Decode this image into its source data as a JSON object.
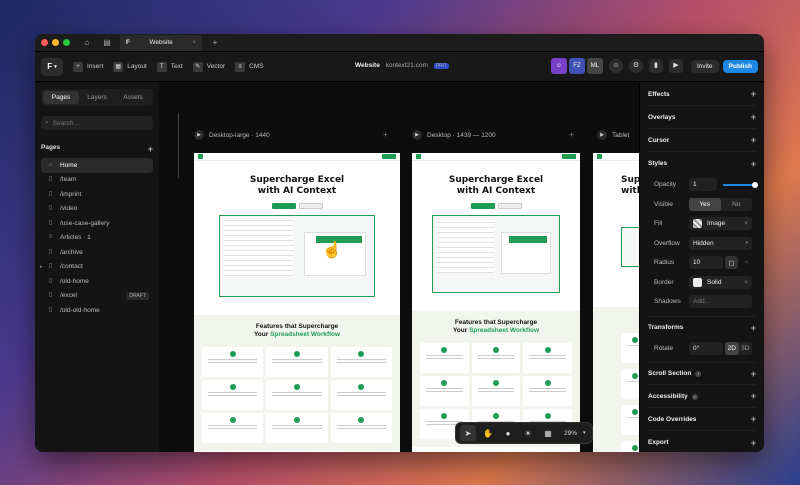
{
  "window": {
    "tab_title": "Website",
    "new_tab": "+",
    "close_tab": "×"
  },
  "toolbar": {
    "logo": "F",
    "tools": [
      {
        "icon": "plus-icon",
        "glyph": "+",
        "label": "Insert"
      },
      {
        "icon": "layout-icon",
        "glyph": "▦",
        "label": "Layout"
      },
      {
        "icon": "text-icon",
        "glyph": "T",
        "label": "Text"
      },
      {
        "icon": "vector-icon",
        "glyph": "✎",
        "label": "Vector"
      },
      {
        "icon": "cms-icon",
        "glyph": "≡",
        "label": "CMS"
      }
    ],
    "project_title": "Website",
    "domain": "kontext21.com",
    "plan_badge": "PRO",
    "avatar_1": "FZ",
    "avatar_2": "ML",
    "invite_label": "Invite",
    "publish_label": "Publish"
  },
  "left_panel": {
    "tabs": [
      "Pages",
      "Layers",
      "Assets"
    ],
    "active_tab": "Pages",
    "search_placeholder": "Search...",
    "pages_heading": "Pages",
    "pages": [
      {
        "label": "Home",
        "active": true
      },
      {
        "label": "/team"
      },
      {
        "label": "/imprint"
      },
      {
        "label": "/video"
      },
      {
        "label": "/use-case-gallery"
      },
      {
        "label": "Articles · 1"
      },
      {
        "label": "/archive"
      },
      {
        "label": "/contact"
      },
      {
        "label": "/old-home"
      },
      {
        "label": "/excel",
        "badge": "DRAFT"
      },
      {
        "label": "/old-old-home"
      }
    ]
  },
  "canvas": {
    "frames": [
      {
        "label": "Desktop-large · 1440"
      },
      {
        "label": "Desktop · 1439 — 1200"
      },
      {
        "label": "Tablet"
      }
    ],
    "hero_title_line1": "Supercharge Excel",
    "hero_title_line2": "with AI Context",
    "features_title_line1": "Features that Supercharge",
    "features_title_line2a": "Your ",
    "features_title_line2b": "Spreadsheet Workflow",
    "zoom": "29%"
  },
  "right_panel": {
    "effects": "Effects",
    "overlays": "Overlays",
    "cursor": "Cursor",
    "styles": "Styles",
    "opacity_label": "Opacity",
    "opacity_value": "1",
    "opacity_level": 1,
    "visible_label": "Visible",
    "visible_yes": "Yes",
    "visible_no": "No",
    "fill_label": "Fill",
    "fill_value": "Image",
    "overflow_label": "Overflow",
    "overflow_value": "Hidden",
    "radius_label": "Radius",
    "radius_value": "10",
    "border_label": "Border",
    "border_value": "Solid",
    "shadows_label": "Shadows",
    "shadows_value": "Add...",
    "transforms": "Transforms",
    "rotate_label": "Rotate",
    "rotate_value": "0°",
    "mode_2d": "2D",
    "mode_3d": "3D",
    "scroll_section": "Scroll Section",
    "accessibility": "Accessibility",
    "code_overrides": "Code Overrides",
    "export": "Export"
  },
  "colors": {
    "accent": "#1e88e5",
    "brand_green": "#1f9d55",
    "highlight_yellow": "#f7d257"
  }
}
